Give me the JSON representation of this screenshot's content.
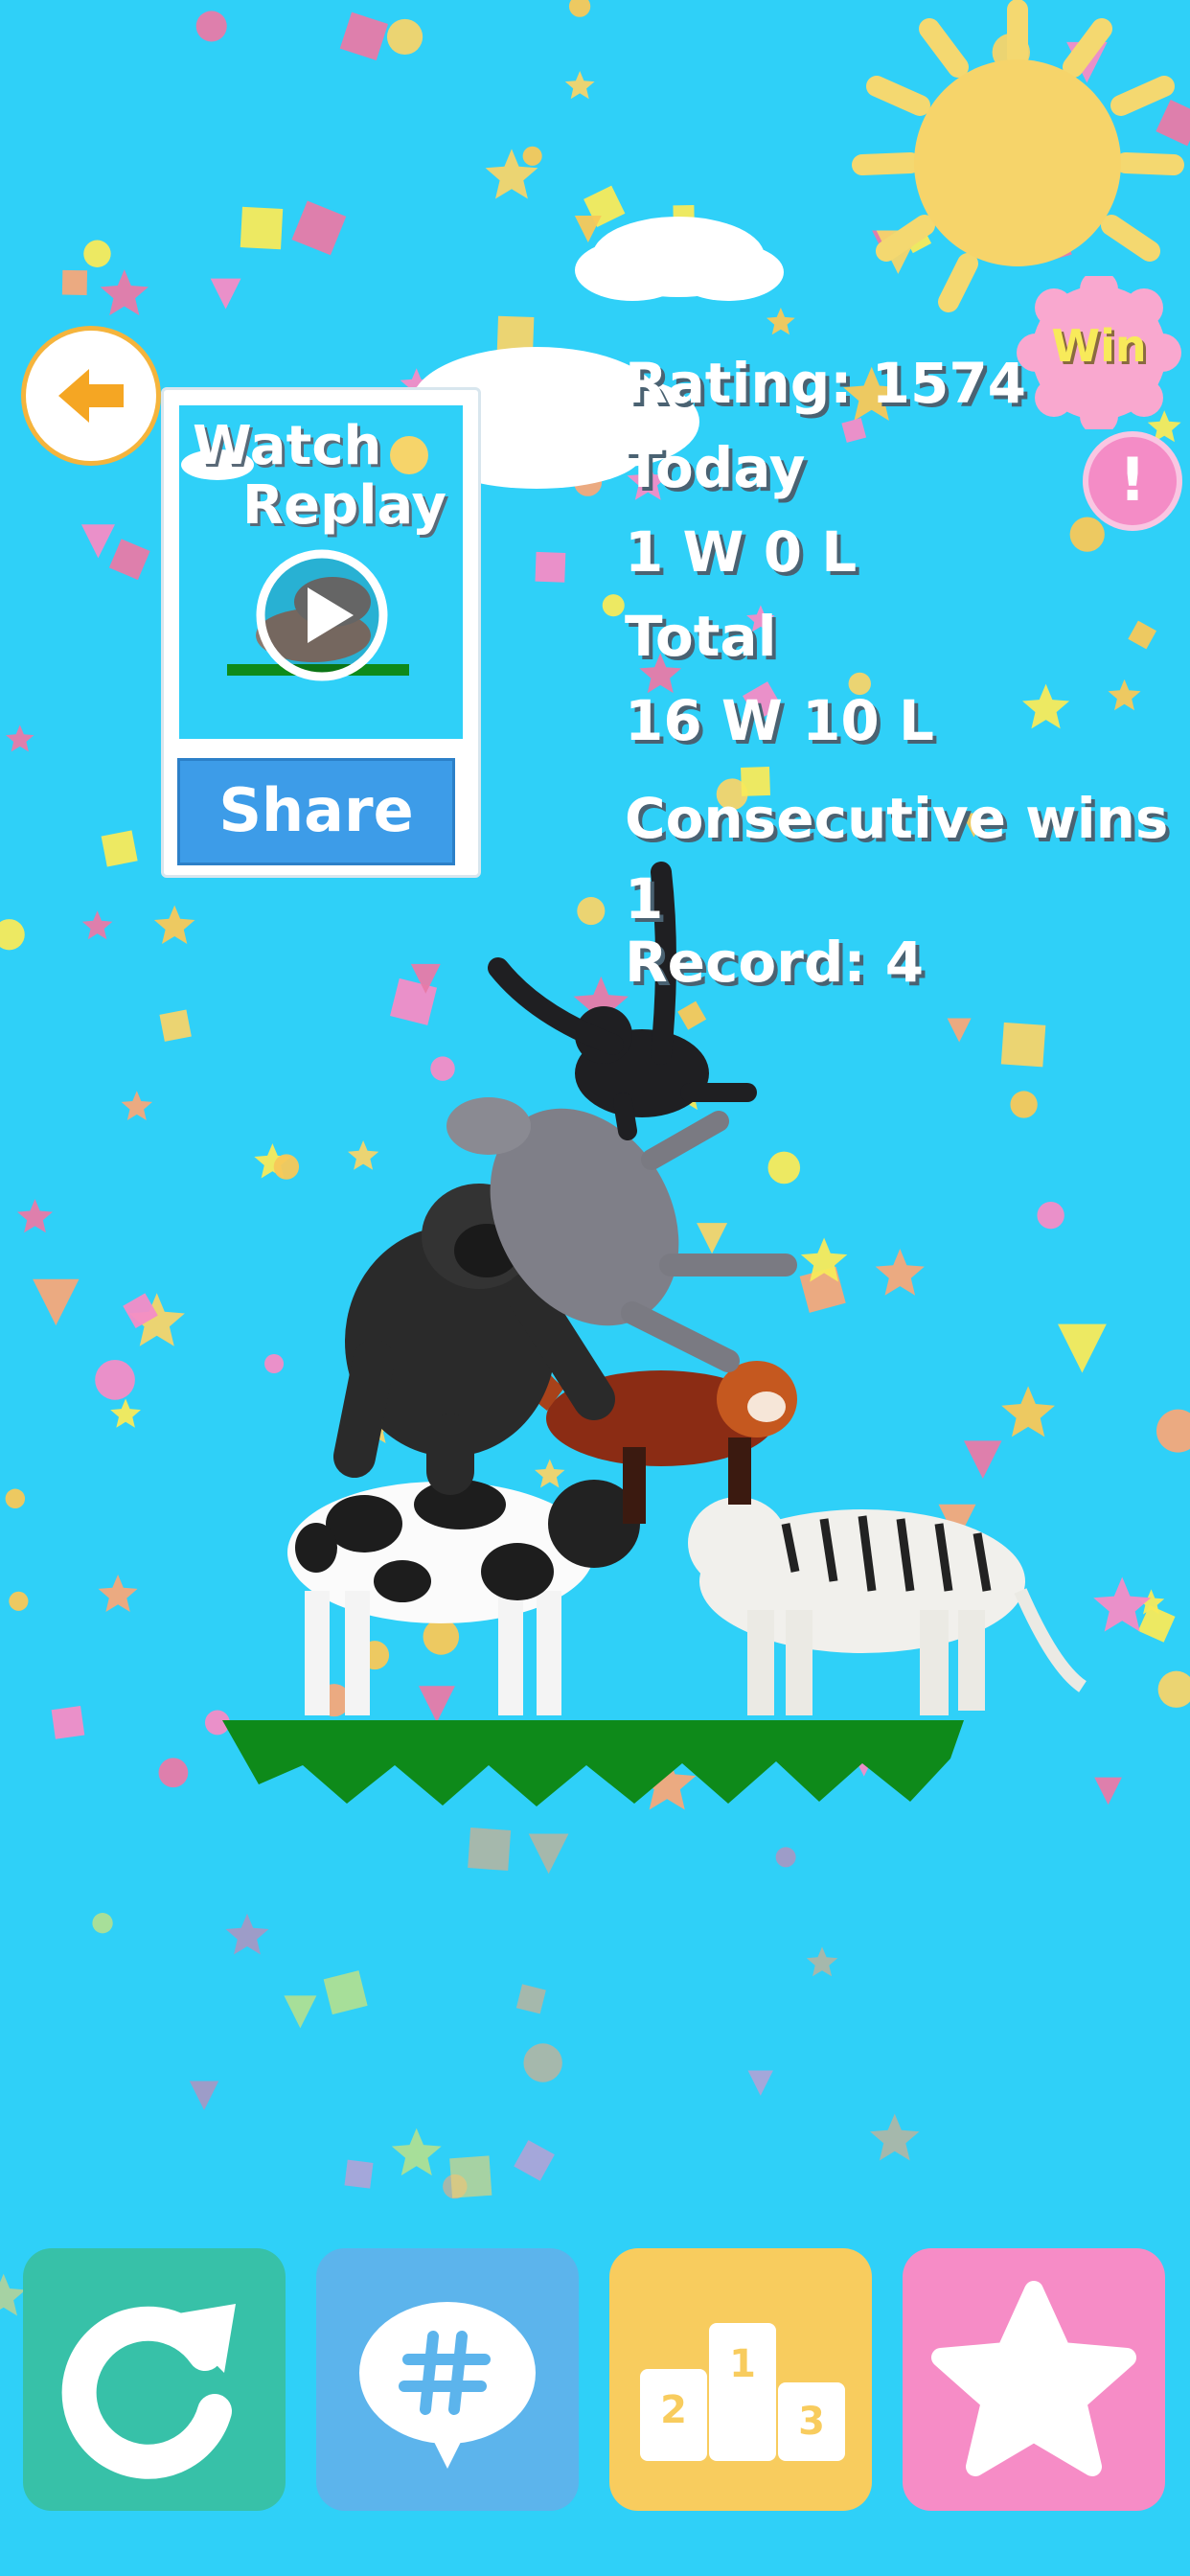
{
  "replay_card": {
    "watch_line1": "Watch",
    "watch_line2": "Replay",
    "share_label": "Share"
  },
  "stats": {
    "rating": "Rating: 1574",
    "today_label": "Today",
    "today_record": "1 W 0 L",
    "total_label": "Total",
    "total_record": "16 W 10 L",
    "consecutive_label": "Consecutive wins",
    "consecutive_value": "1",
    "best_streak": "Record: 4"
  },
  "badge": {
    "result": "Win",
    "alert_symbol": "!"
  },
  "podium_numbers": [
    "2",
    "1",
    "3"
  ],
  "stacked_animals": [
    "gibbon",
    "donkey",
    "gorilla",
    "red panda",
    "cow",
    "white tiger"
  ],
  "icons": {
    "back": "back-arrow-icon",
    "play": "play-icon",
    "restart": "restart-icon",
    "hashtag": "hashtag-bubble-icon",
    "ranking": "podium-icon",
    "favorite": "star-icon"
  },
  "colors": {
    "background": "#2fd0f8",
    "restart_button": "#37c1a8",
    "hashtag_button": "#5cb4ec",
    "ranking_button": "#f8cc5e",
    "favorite_button": "#f68cc6",
    "share_button": "#3d9ce8",
    "ground": "#0e8a1a"
  }
}
